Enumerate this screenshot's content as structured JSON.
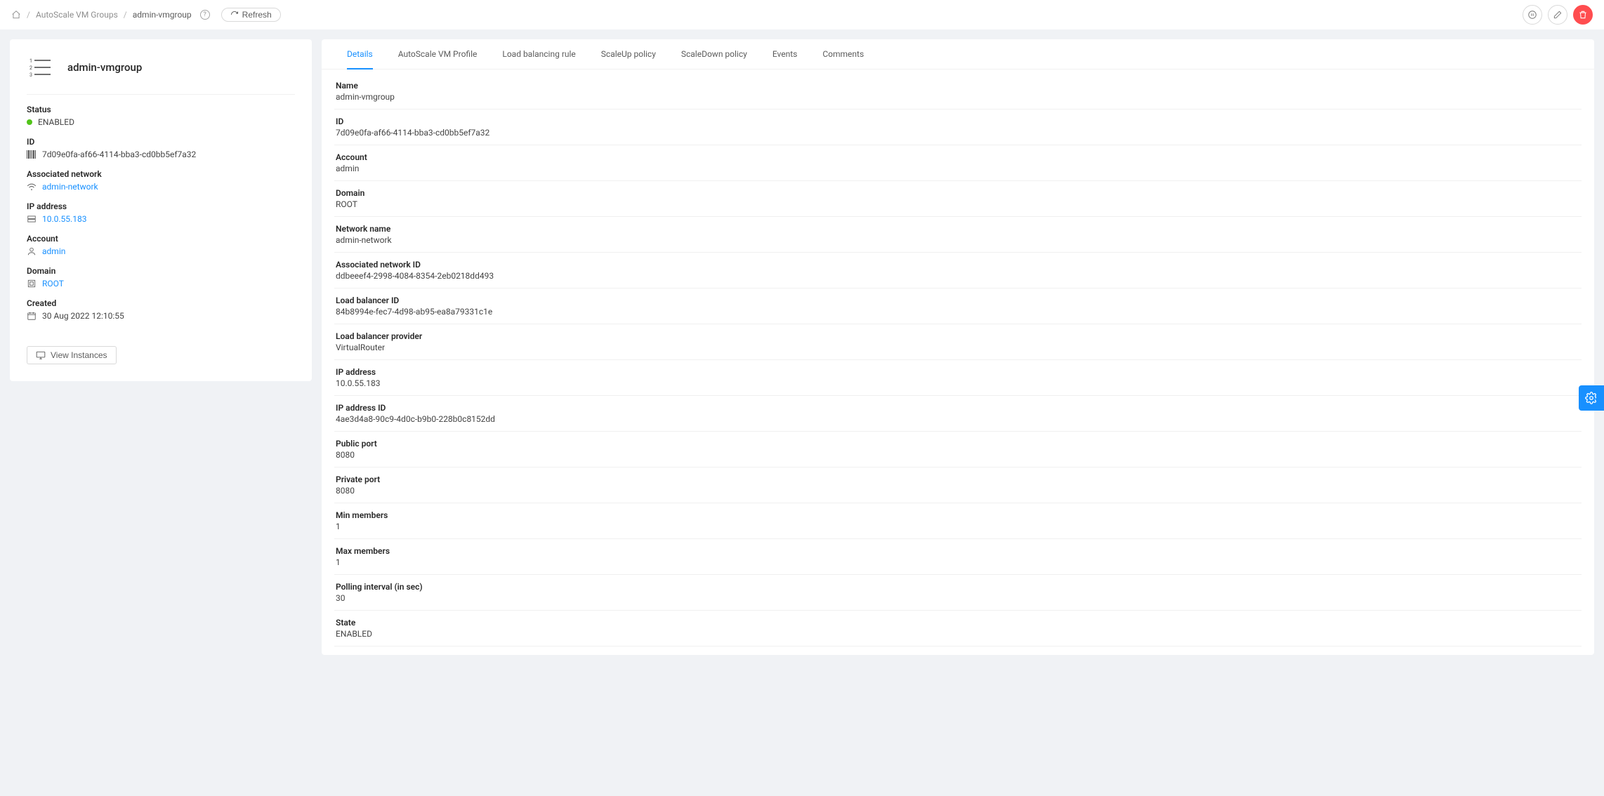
{
  "breadcrumb": {
    "groups": "AutoScale VM Groups",
    "current": "admin-vmgroup"
  },
  "refresh_label": "Refresh",
  "sidebar": {
    "title": "admin-vmgroup",
    "status_label": "Status",
    "status_value": "ENABLED",
    "id_label": "ID",
    "id_value": "7d09e0fa-af66-4114-bba3-cd0bb5ef7a32",
    "network_label": "Associated network",
    "network_value": "admin-network",
    "ip_label": "IP address",
    "ip_value": "10.0.55.183",
    "account_label": "Account",
    "account_value": "admin",
    "domain_label": "Domain",
    "domain_value": "ROOT",
    "created_label": "Created",
    "created_value": "30 Aug 2022 12:10:55",
    "view_instances": "View Instances"
  },
  "tabs": [
    "Details",
    "AutoScale VM Profile",
    "Load balancing rule",
    "ScaleUp policy",
    "ScaleDown policy",
    "Events",
    "Comments"
  ],
  "details": [
    {
      "label": "Name",
      "value": "admin-vmgroup"
    },
    {
      "label": "ID",
      "value": "7d09e0fa-af66-4114-bba3-cd0bb5ef7a32"
    },
    {
      "label": "Account",
      "value": "admin"
    },
    {
      "label": "Domain",
      "value": "ROOT"
    },
    {
      "label": "Network name",
      "value": "admin-network"
    },
    {
      "label": "Associated network ID",
      "value": "ddbeeef4-2998-4084-8354-2eb0218dd493"
    },
    {
      "label": "Load balancer ID",
      "value": "84b8994e-fec7-4d98-ab95-ea8a79331c1e"
    },
    {
      "label": "Load balancer provider",
      "value": "VirtualRouter"
    },
    {
      "label": "IP address",
      "value": "10.0.55.183"
    },
    {
      "label": "IP address ID",
      "value": "4ae3d4a8-90c9-4d0c-b9b0-228b0c8152dd"
    },
    {
      "label": "Public port",
      "value": "8080"
    },
    {
      "label": "Private port",
      "value": "8080"
    },
    {
      "label": "Min members",
      "value": "1"
    },
    {
      "label": "Max members",
      "value": "1"
    },
    {
      "label": "Polling interval (in sec)",
      "value": "30"
    },
    {
      "label": "State",
      "value": "ENABLED"
    }
  ]
}
